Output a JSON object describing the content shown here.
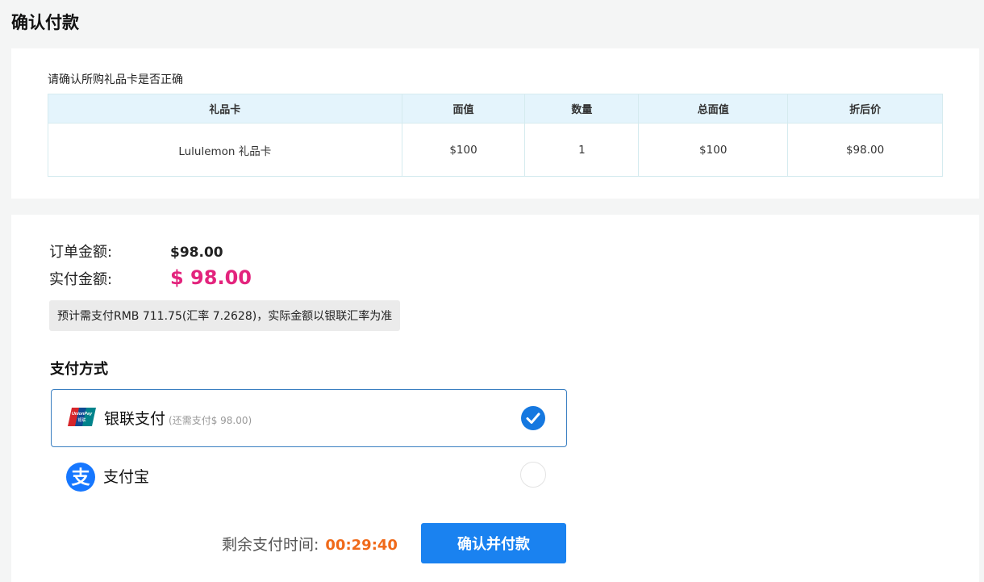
{
  "page_title": "确认付款",
  "confirm_hint": "请确认所购礼品卡是否正确",
  "table": {
    "headers": [
      "礼品卡",
      "面值",
      "数量",
      "总面值",
      "折后价"
    ],
    "rows": [
      [
        "Lululemon 礼品卡",
        "$100",
        "1",
        "$100",
        "$98.00"
      ]
    ]
  },
  "summary": {
    "order_label": "订单金额:",
    "order_value": "$98.00",
    "paid_label": "实付金额:",
    "paid_value": "$ 98.00",
    "rate_note": "预计需支付RMB 711.75(汇率 7.2628)，实际金额以银联汇率为准"
  },
  "payment": {
    "title": "支付方式",
    "options": [
      {
        "name": "银联支付",
        "sub": "(还需支付$ 98.00)",
        "icon": "unionpay-icon",
        "selected": true
      },
      {
        "name": "支付宝",
        "sub": "",
        "icon": "alipay-icon",
        "selected": false
      }
    ]
  },
  "footer": {
    "timer_label": "剩余支付时间:",
    "timer_value": "00:29:40",
    "confirm_label": "确认并付款"
  },
  "colors": {
    "accent": "#1a82f0",
    "price": "#e3247d",
    "timer": "#f06a1a",
    "table_header": "#e4f4fc"
  }
}
